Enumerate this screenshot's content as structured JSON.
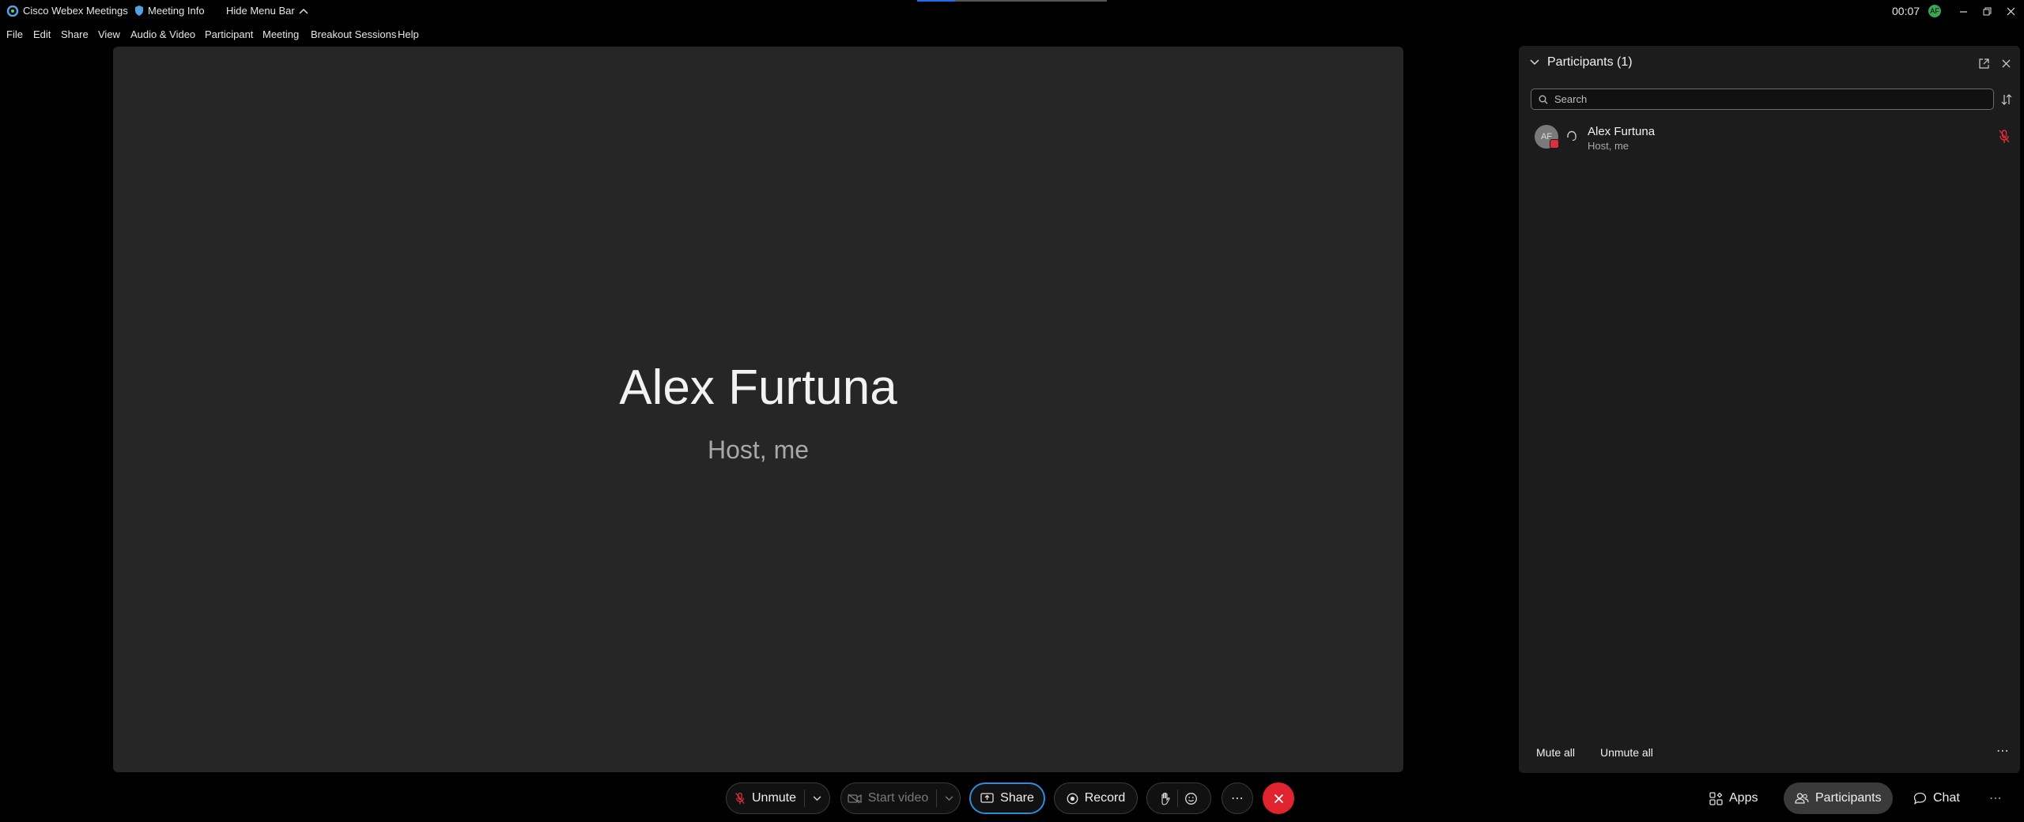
{
  "titlebar": {
    "app_name": "Cisco Webex Meetings",
    "meeting_info": "Meeting Info",
    "hide_menu_bar": "Hide Menu Bar",
    "time": "00:07",
    "status_initials": "AF"
  },
  "menu": {
    "items": [
      "File",
      "Edit",
      "Share",
      "View",
      "Audio & Video",
      "Participant",
      "Meeting",
      "Breakout Sessions",
      "Help"
    ]
  },
  "stage": {
    "name": "Alex Furtuna",
    "role": "Host, me"
  },
  "participants_panel": {
    "title": "Participants (1)",
    "search_placeholder": "Search",
    "participants": [
      {
        "initials": "AF",
        "name": "Alex Furtuna",
        "role": "Host, me"
      }
    ],
    "mute_all": "Mute all",
    "unmute_all": "Unmute all"
  },
  "controls": {
    "unmute": "Unmute",
    "start_video": "Start video",
    "share": "Share",
    "record": "Record",
    "apps": "Apps",
    "participants": "Participants",
    "chat": "Chat"
  },
  "colors": {
    "leave": "#e0242f",
    "share_border": "#2f8ad8",
    "muted_red": "#e02d3c",
    "status_green": "#3aa655"
  }
}
